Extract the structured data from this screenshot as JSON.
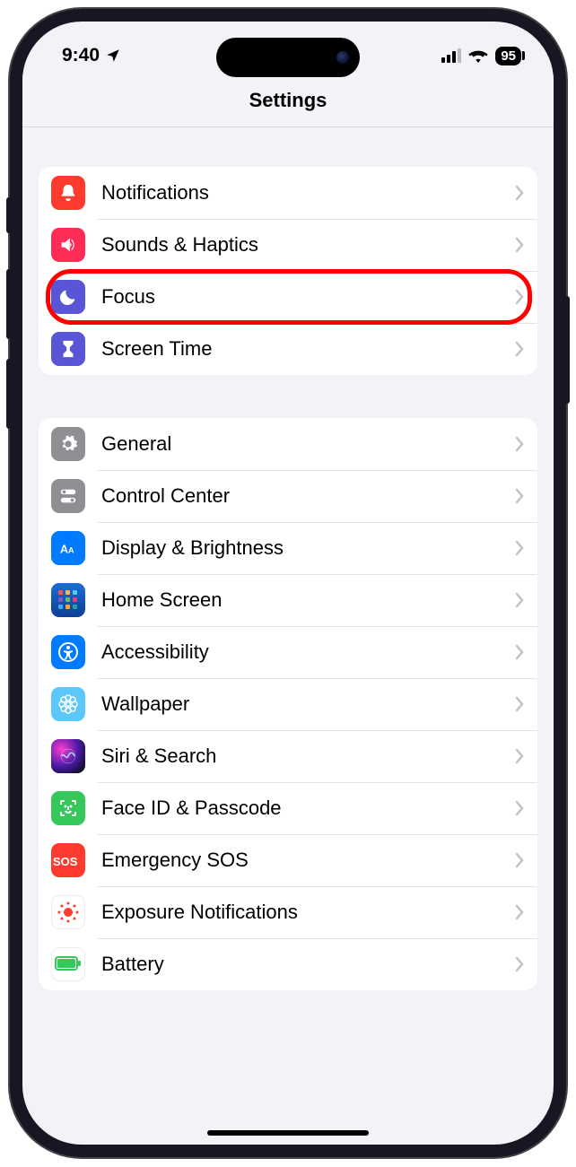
{
  "status_bar": {
    "time": "9:40",
    "location_icon": "location-arrow",
    "battery_level": "95"
  },
  "header": {
    "title": "Settings"
  },
  "groups": [
    {
      "rows": [
        {
          "name": "notifications",
          "icon": "bell-icon",
          "bg": "bg-red",
          "label": "Notifications",
          "highlight": false
        },
        {
          "name": "sounds-haptics",
          "icon": "speaker-icon",
          "bg": "bg-pink",
          "label": "Sounds & Haptics",
          "highlight": false
        },
        {
          "name": "focus",
          "icon": "moon-icon",
          "bg": "bg-indigo",
          "label": "Focus",
          "highlight": true
        },
        {
          "name": "screen-time",
          "icon": "hourglass-icon",
          "bg": "bg-indigo",
          "label": "Screen Time",
          "highlight": false
        }
      ]
    },
    {
      "rows": [
        {
          "name": "general",
          "icon": "gear-icon",
          "bg": "bg-gray",
          "label": "General",
          "highlight": false
        },
        {
          "name": "control-center",
          "icon": "toggles-icon",
          "bg": "bg-gray",
          "label": "Control Center",
          "highlight": false
        },
        {
          "name": "display-brightness",
          "icon": "textsize-icon",
          "bg": "bg-blue",
          "label": "Display & Brightness",
          "highlight": false
        },
        {
          "name": "home-screen",
          "icon": "apps-icon",
          "bg": "bg-dblue",
          "label": "Home Screen",
          "highlight": false
        },
        {
          "name": "accessibility",
          "icon": "accessibility-icon",
          "bg": "bg-blue",
          "label": "Accessibility",
          "highlight": false
        },
        {
          "name": "wallpaper",
          "icon": "flower-icon",
          "bg": "bg-cyan",
          "label": "Wallpaper",
          "highlight": false
        },
        {
          "name": "siri-search",
          "icon": "siri-icon",
          "bg": "bg-siri",
          "label": "Siri & Search",
          "highlight": false
        },
        {
          "name": "face-id",
          "icon": "faceid-icon",
          "bg": "bg-green",
          "label": "Face ID & Passcode",
          "highlight": false
        },
        {
          "name": "emergency-sos",
          "icon": "sos-icon",
          "bg": "bg-sos",
          "label": "Emergency SOS",
          "highlight": false
        },
        {
          "name": "exposure-notifications",
          "icon": "exposure-icon",
          "bg": "bg-white",
          "label": "Exposure Notifications",
          "highlight": false
        },
        {
          "name": "battery",
          "icon": "battery-icon",
          "bg": "bg-batt",
          "label": "Battery",
          "highlight": false
        }
      ]
    }
  ]
}
